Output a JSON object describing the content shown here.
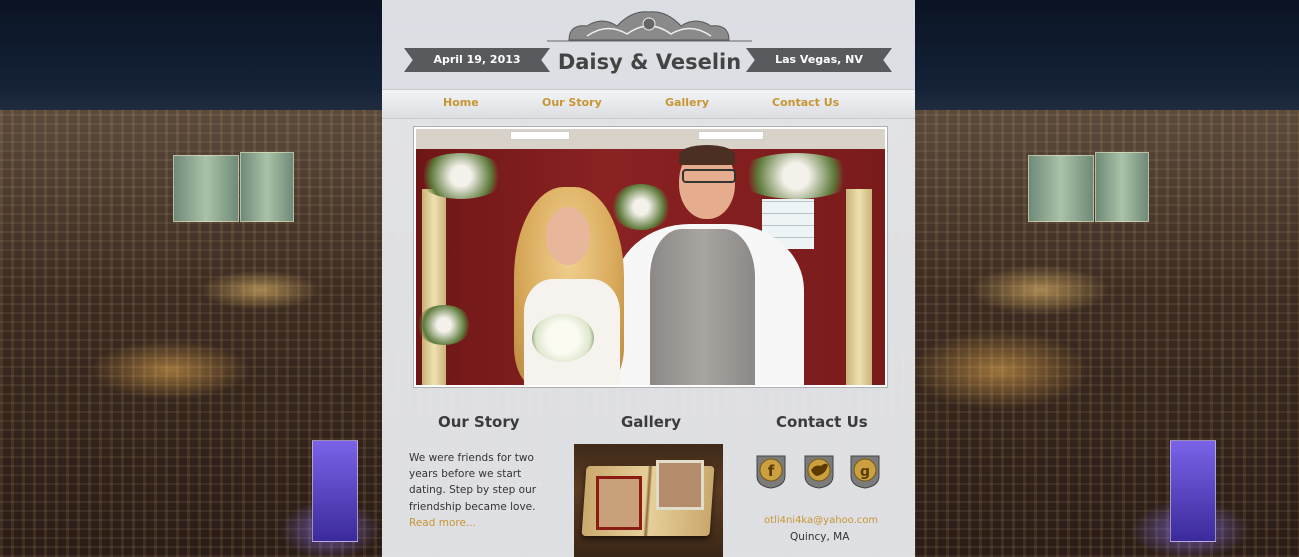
{
  "header": {
    "date": "April 19, 2013",
    "title": "Daisy & Veselin",
    "location": "Las Vegas, NV"
  },
  "nav": {
    "items": [
      {
        "label": "Home"
      },
      {
        "label": "Our Story"
      },
      {
        "label": "Gallery"
      },
      {
        "label": "Contact Us"
      }
    ]
  },
  "sections": {
    "story": {
      "heading": "Our Story",
      "body": "We were friends for two years before we start dating. Step by step our friendship became love.",
      "read_more": "Read more..."
    },
    "gallery": {
      "heading": "Gallery"
    },
    "contact": {
      "heading": "Contact Us",
      "email": "otli4ni4ka@yahoo.com",
      "city": "Quincy, MA",
      "social_icons": [
        "facebook-icon",
        "twitter-icon",
        "google-plus-icon"
      ]
    }
  },
  "colors": {
    "accent": "#c89534",
    "ribbon": "#585a5e",
    "panel": "#eceef2",
    "heading": "#3b3b3b"
  }
}
